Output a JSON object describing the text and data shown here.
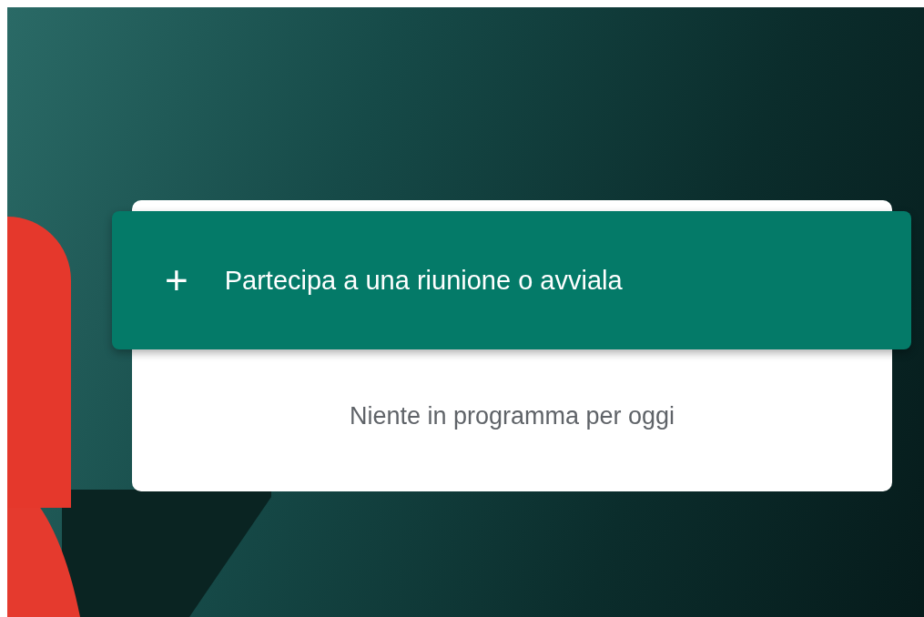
{
  "join_button": {
    "icon": "+",
    "label": "Partecipa a una riunione o avviala"
  },
  "empty_message": "Niente in programma per oggi"
}
